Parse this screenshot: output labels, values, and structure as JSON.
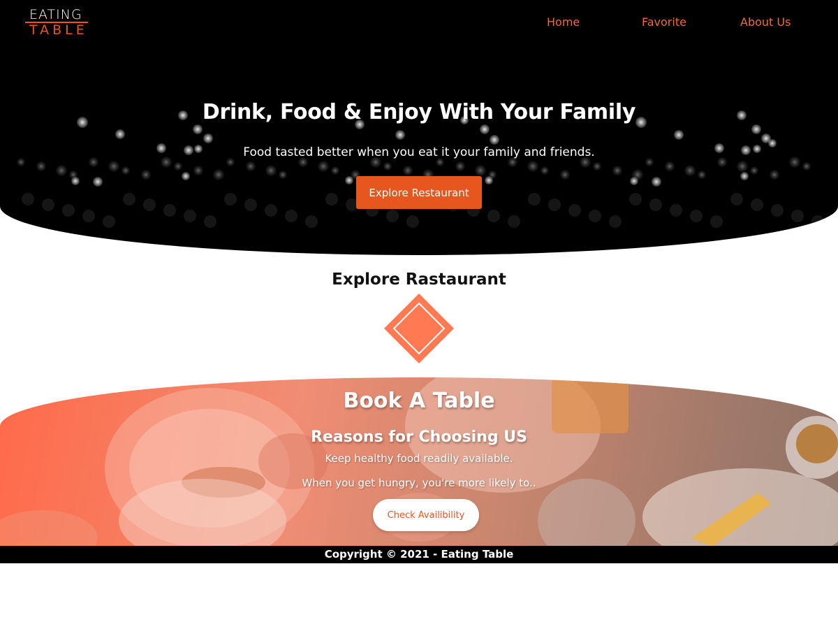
{
  "brand": {
    "logo_top": "EATING",
    "logo_bottom": "TABLE",
    "accent": "#e8561f",
    "nav_color": "#f06a3b"
  },
  "nav": {
    "home": "Home",
    "favorite": "Favorite",
    "about": "About Us"
  },
  "hero": {
    "title": "Drink, Food & Enjoy With Your Family",
    "subtitle": "Food tasted better when you eat it your family and friends.",
    "button": "Explore Restaurant"
  },
  "explore": {
    "title": "Explore Rastaurant",
    "icon": "diamond-icon"
  },
  "book": {
    "title": "Book A Table",
    "subtitle": "Reasons for Choosing US",
    "line1": "Keep healthy food readily available.",
    "line2": "When you get hungry, you're more likely to..",
    "button": "Check Availibility"
  },
  "footer": {
    "text": "Copyright © 2021 - Eating Table"
  }
}
